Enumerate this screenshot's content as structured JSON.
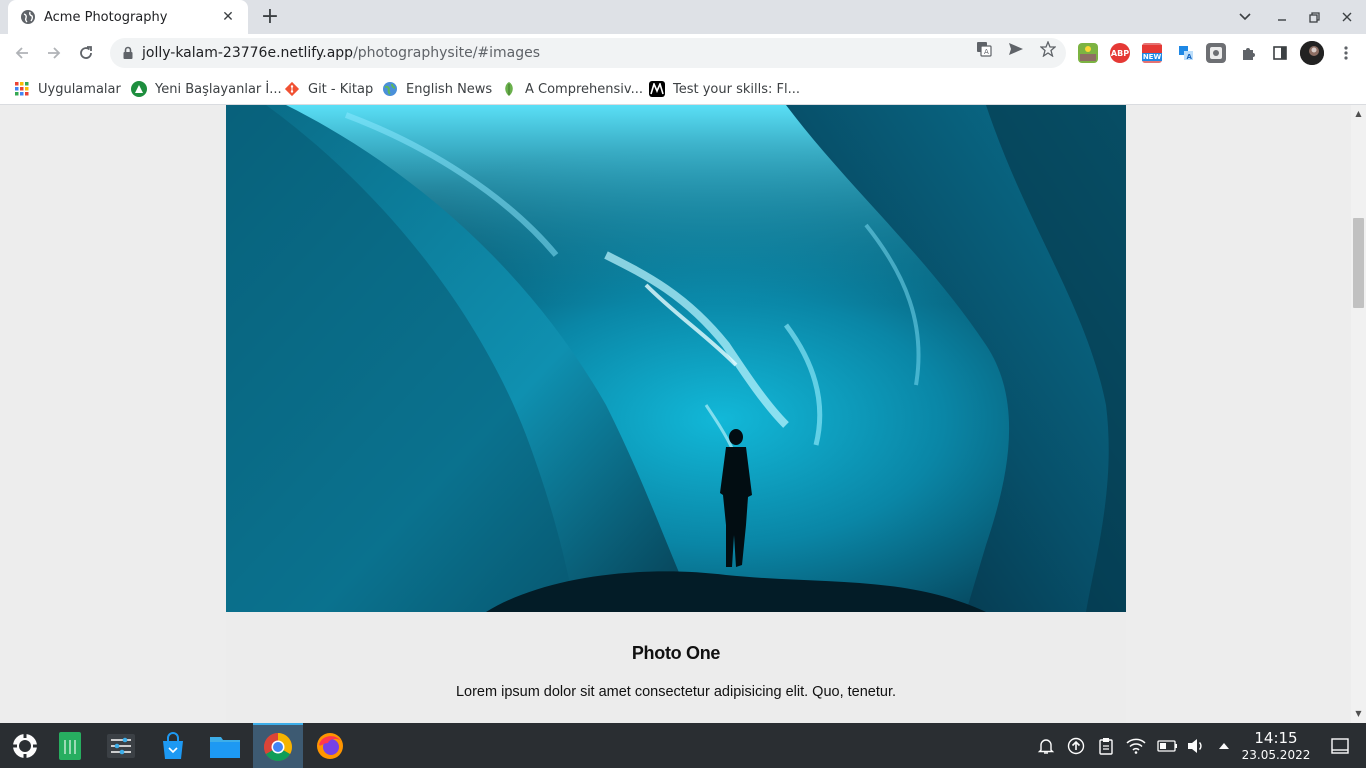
{
  "browser": {
    "tab_title": "Acme Photography",
    "tab_close": "✕",
    "new_tab": "+",
    "url_host": "jolly-kalam-23776e.netlify.app",
    "url_path": "/photographysite/#images"
  },
  "bookmarks": [
    {
      "label": "Uygulamalar",
      "icon": "apps-grid-icon"
    },
    {
      "label": "Yeni Başlayanlar İ...",
      "icon": "leaf-green-icon"
    },
    {
      "label": "Git - Kitap",
      "icon": "git-icon"
    },
    {
      "label": "English News",
      "icon": "globe-icon"
    },
    {
      "label": "A Comprehensiv...",
      "icon": "leaf-icon"
    },
    {
      "label": "Test your skills: Fl...",
      "icon": "mdn-icon"
    }
  ],
  "extensions": {
    "abp": "ABP",
    "new": "NEW"
  },
  "page": {
    "photo_title": "Photo One",
    "photo_text": "Lorem ipsum dolor sit amet consectetur adipisicing elit. Quo, tenetur."
  },
  "taskbar": {
    "time": "14:15",
    "date": "23.05.2022"
  },
  "colors": {
    "accent": "#3daee9",
    "taskbar_bg": "#2a2e32",
    "ice_light": "#19c6e6",
    "ice_dark": "#063a4e"
  }
}
